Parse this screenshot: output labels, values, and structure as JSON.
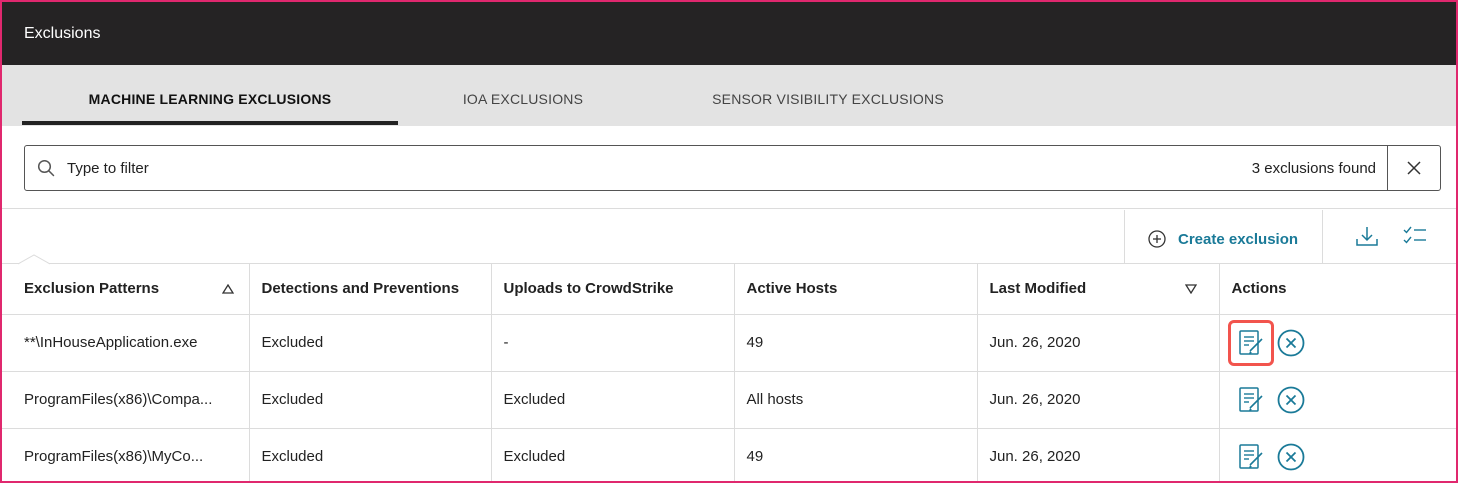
{
  "window": {
    "title": "Exclusions"
  },
  "tabs": [
    {
      "label": "MACHINE LEARNING EXCLUSIONS",
      "active": true
    },
    {
      "label": "IOA EXCLUSIONS",
      "active": false
    },
    {
      "label": "SENSOR VISIBILITY EXCLUSIONS",
      "active": false
    }
  ],
  "filter": {
    "placeholder": "Type to filter",
    "value": "",
    "result_count": "3 exclusions found"
  },
  "toolbar": {
    "create_label": "Create exclusion",
    "icons": [
      "plus-circle-icon",
      "download-icon",
      "checklist-icon"
    ]
  },
  "table": {
    "columns": [
      {
        "label": "Exclusion Patterns",
        "sort": "asc"
      },
      {
        "label": "Detections and Preventions"
      },
      {
        "label": "Uploads to CrowdStrike"
      },
      {
        "label": "Active Hosts"
      },
      {
        "label": "Last Modified",
        "sort": "desc"
      },
      {
        "label": "Actions"
      }
    ],
    "rows": [
      {
        "pattern": "**\\InHouseApplication.exe",
        "detections": "Excluded",
        "uploads": "-",
        "hosts": "49",
        "modified": "Jun. 26, 2020",
        "highlight_edit": true
      },
      {
        "pattern": "ProgramFiles(x86)\\Compa...",
        "detections": "Excluded",
        "uploads": "Excluded",
        "hosts": "All hosts",
        "modified": "Jun. 26, 2020",
        "highlight_edit": false
      },
      {
        "pattern": "ProgramFiles(x86)\\MyCo...",
        "detections": "Excluded",
        "uploads": "Excluded",
        "hosts": "49",
        "modified": "Jun. 26, 2020",
        "highlight_edit": false
      }
    ]
  },
  "colors": {
    "title_bar": "#252324",
    "tab_bar": "#e3e3e3",
    "accent": "#1a7a98",
    "highlight": "#f2544d",
    "frame_border": "#e0286e"
  }
}
